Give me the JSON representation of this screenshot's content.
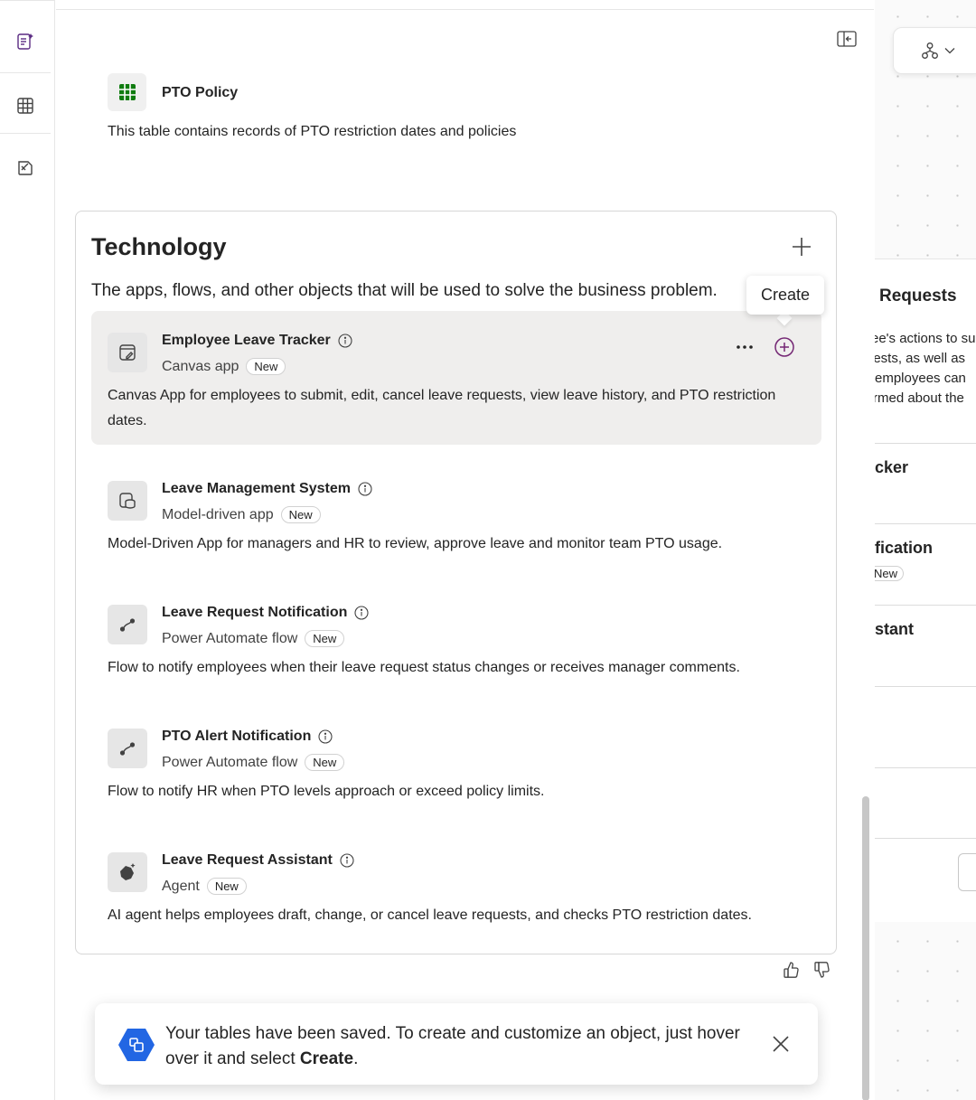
{
  "rail": {
    "items": [
      {
        "name": "plan-icon"
      },
      {
        "name": "data-table-icon"
      },
      {
        "name": "sketch-icon"
      }
    ]
  },
  "table_item": {
    "title": "PTO Policy",
    "description": "This table contains records of PTO restriction dates and policies"
  },
  "technology": {
    "title": "Technology",
    "description": "The apps, flows, and other objects that will be used to solve the business problem.",
    "tooltip": "Create",
    "items": [
      {
        "name": "Employee Leave Tracker",
        "type": "Canvas app",
        "badge": "New",
        "description": "Canvas App for employees to submit, edit, cancel leave requests, view leave history, and PTO restriction dates.",
        "icon": "canvas-app-icon"
      },
      {
        "name": "Leave Management System",
        "type": "Model-driven app",
        "badge": "New",
        "description": "Model-Driven App for managers and HR to review, approve leave and monitor team PTO usage.",
        "icon": "model-driven-app-icon"
      },
      {
        "name": "Leave Request Notification",
        "type": "Power Automate flow",
        "badge": "New",
        "description": "Flow to notify employees when their leave request status changes or receives manager comments.",
        "icon": "flow-icon"
      },
      {
        "name": "PTO Alert Notification",
        "type": "Power Automate flow",
        "badge": "New",
        "description": "Flow to notify HR when PTO levels approach or exceed policy limits.",
        "icon": "flow-icon"
      },
      {
        "name": "Leave Request Assistant",
        "type": "Agent",
        "badge": "New",
        "description": "AI agent helps employees draft, change, or cancel leave requests, and checks PTO restriction dates.",
        "icon": "agent-icon"
      }
    ]
  },
  "toast": {
    "message_prefix": "Your tables have been saved. To create and customize an object, just hover over it and select ",
    "message_bold": "Create",
    "message_suffix": "."
  },
  "right_panel": {
    "title_partial": "Requests",
    "desc_lines": [
      "ee's actions to su",
      "uests, as well as",
      "employees can",
      "rmed about the"
    ],
    "sections": [
      {
        "title": "cker",
        "badge": ""
      },
      {
        "title": "fication",
        "badge": "New"
      },
      {
        "title": "stant",
        "badge": ""
      }
    ]
  },
  "colors": {
    "accent_purple": "#742774",
    "table_icon_green": "#107c10",
    "toast_icon_blue": "#2266e3"
  }
}
